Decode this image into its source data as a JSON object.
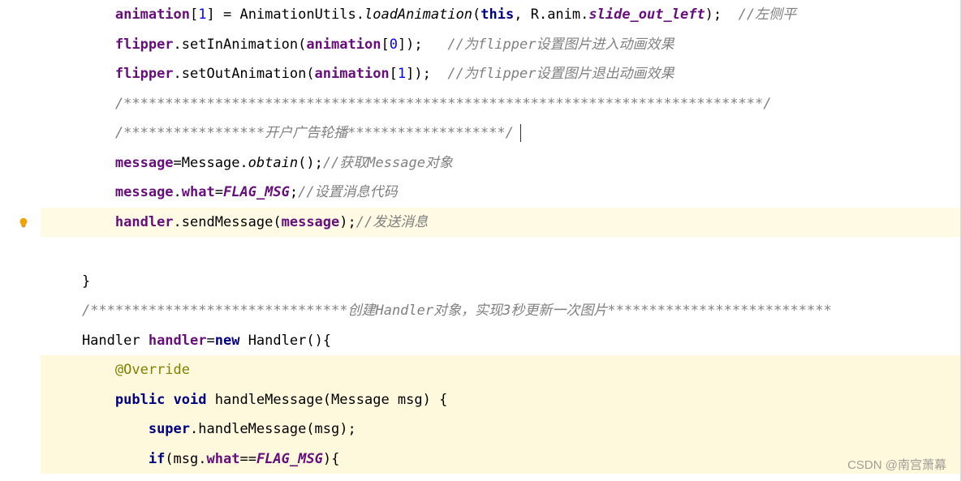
{
  "code": {
    "l1": {
      "p1": "        ",
      "p2": "animation",
      "p3": "[",
      "p4": "1",
      "p5": "] = AnimationUtils.",
      "p6": "loadAnimation",
      "p7": "(",
      "p8": "this",
      "p9": ", R.anim.",
      "p10": "slide_out_left",
      "p11": ");  ",
      "p12": "//左侧平"
    },
    "l2": {
      "p1": "        ",
      "p2": "flipper",
      "p3": ".setInAnimation(",
      "p4": "animation",
      "p5": "[",
      "p6": "0",
      "p7": "]);   ",
      "p8": "//为flipper设置图片进入动画效果"
    },
    "l3": {
      "p1": "        ",
      "p2": "flipper",
      "p3": ".setOutAnimation(",
      "p4": "animation",
      "p5": "[",
      "p6": "1",
      "p7": "]);  ",
      "p8": "//为flipper设置图片退出动画效果"
    },
    "l4": {
      "p1": "        ",
      "p2": "/*****************************************************************************/"
    },
    "l5": {
      "p1": "        ",
      "p2": "/*****************开户广告轮播*******************/"
    },
    "l6": {
      "p1": "        ",
      "p2": "message",
      "p3": "=Message.",
      "p4": "obtain",
      "p5": "();",
      "p6": "//获取Message对象"
    },
    "l7": {
      "p1": "        ",
      "p2": "message",
      "p3": ".",
      "p4": "what",
      "p5": "=",
      "p6": "FLAG_MSG",
      "p7": ";",
      "p8": "//设置消息代码"
    },
    "l8": {
      "p1": "        ",
      "p2": "handler",
      "p3": ".sendMessage(",
      "p4": "message",
      "p5": ");",
      "p6": "//发送消息"
    },
    "l9": {
      "p1": ""
    },
    "l10": {
      "p1": "    }"
    },
    "l11": {
      "p1": "    ",
      "p2": "/*******************************创建Handler对象，实现3秒更新一次图片***************************"
    },
    "l12": {
      "p1": "    Handler ",
      "p2": "handler",
      "p3": "=",
      "p4": "new",
      "p5": " Handler(){"
    },
    "l13": {
      "p1": "        ",
      "p2": "@Override"
    },
    "l14": {
      "p1": "        ",
      "p2": "public",
      "p3": " ",
      "p4": "void",
      "p5": " handleMessage(Message msg) {"
    },
    "l15": {
      "p1": "            ",
      "p2": "super",
      "p3": ".handleMessage(msg);"
    },
    "l16": {
      "p1": "            ",
      "p2": "if",
      "p3": "(msg.",
      "p4": "what",
      "p5": "==",
      "p6": "FLAG_MSG",
      "p7": "){"
    }
  },
  "watermark": "CSDN @南宫萧幕"
}
